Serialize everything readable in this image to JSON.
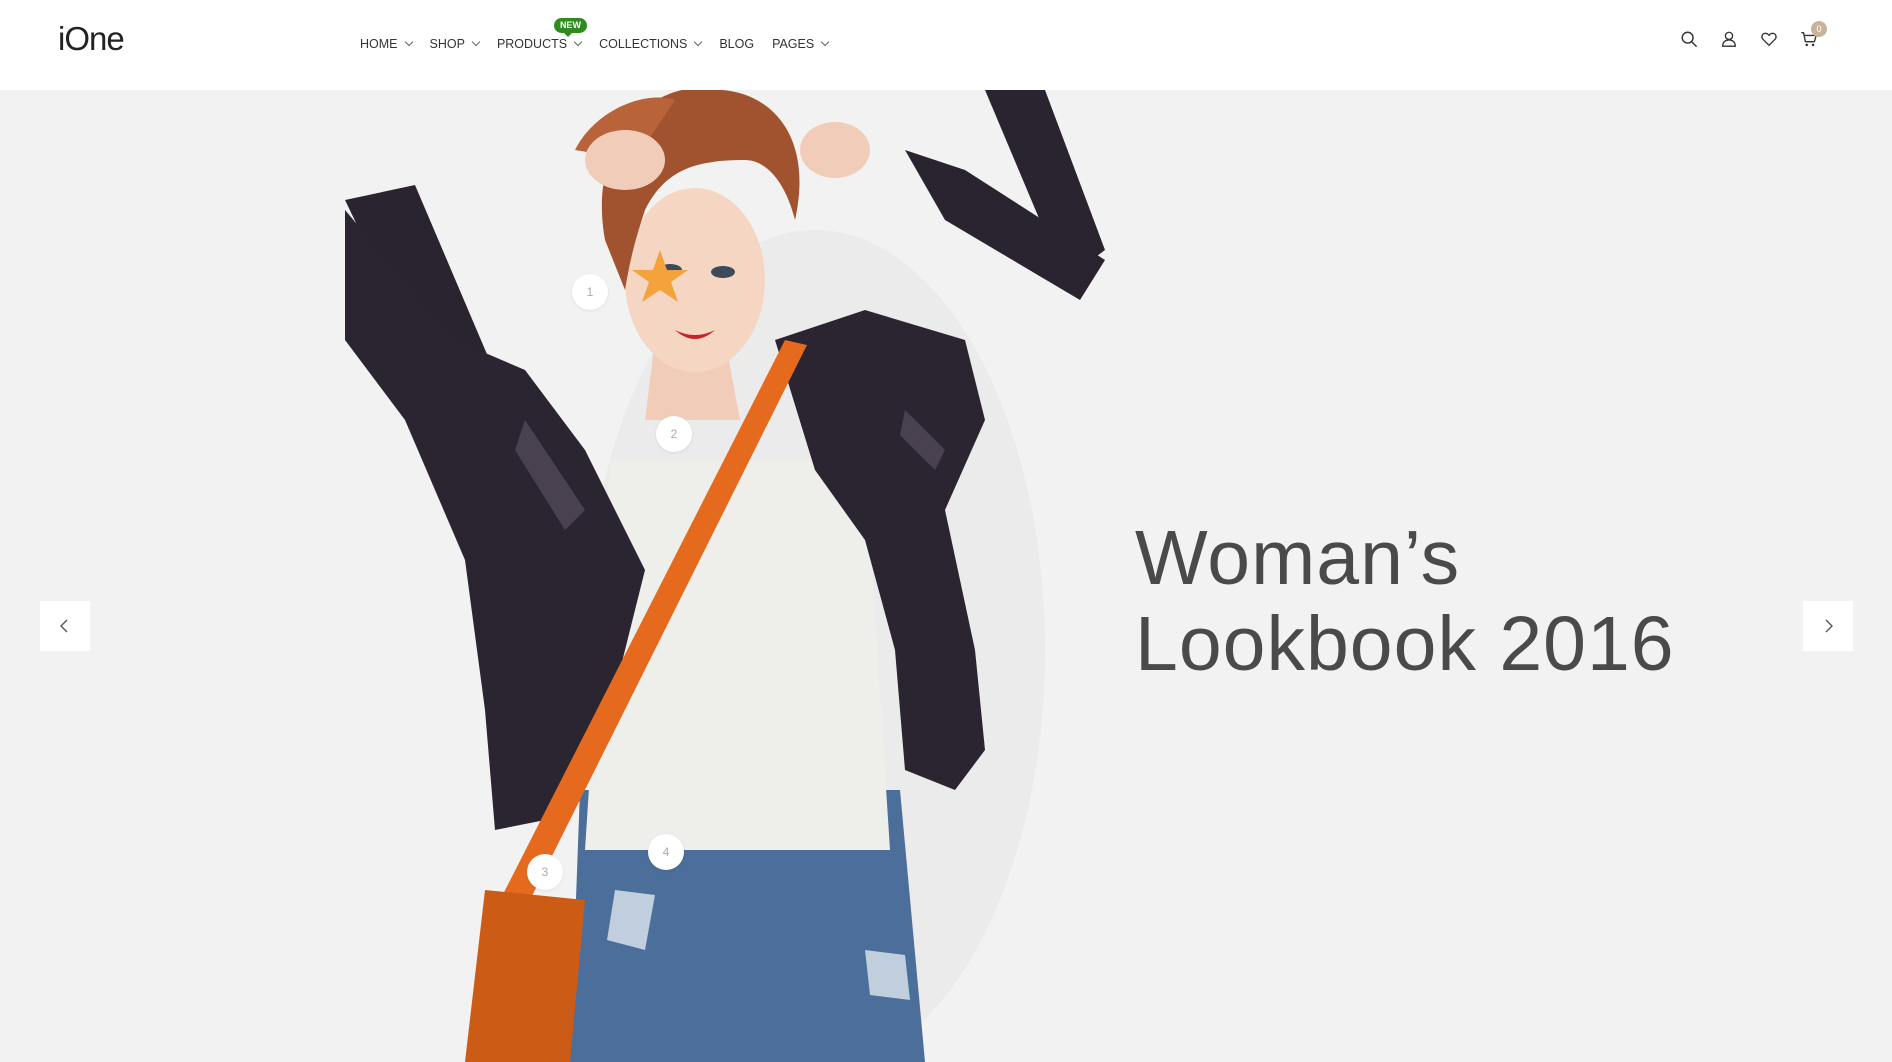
{
  "header": {
    "logo": "iOne",
    "nav": [
      {
        "label": "HOME",
        "has_dropdown": true
      },
      {
        "label": "SHOP",
        "has_dropdown": true
      },
      {
        "label": "PRODUCTS",
        "has_dropdown": true,
        "badge": "New"
      },
      {
        "label": "COLLECTIONS",
        "has_dropdown": true
      },
      {
        "label": "BLOG",
        "has_dropdown": false
      },
      {
        "label": "PAGES",
        "has_dropdown": true
      }
    ],
    "icons": [
      "search-icon",
      "user-icon",
      "heart-icon",
      "cart-icon"
    ],
    "cart_count": "0"
  },
  "hero": {
    "headline_line1": "Woman’s",
    "headline_line2": "Lookbook 2016",
    "hotspots": [
      "1",
      "2",
      "3",
      "4"
    ],
    "prev_icon": "chevron-left-icon",
    "next_icon": "chevron-right-icon"
  },
  "colors": {
    "background": "#f2f2f2",
    "header_bg": "#ffffff",
    "badge_green": "#2e8b1e",
    "cart_badge": "#c9b39a",
    "headline": "#4a4a4a"
  }
}
